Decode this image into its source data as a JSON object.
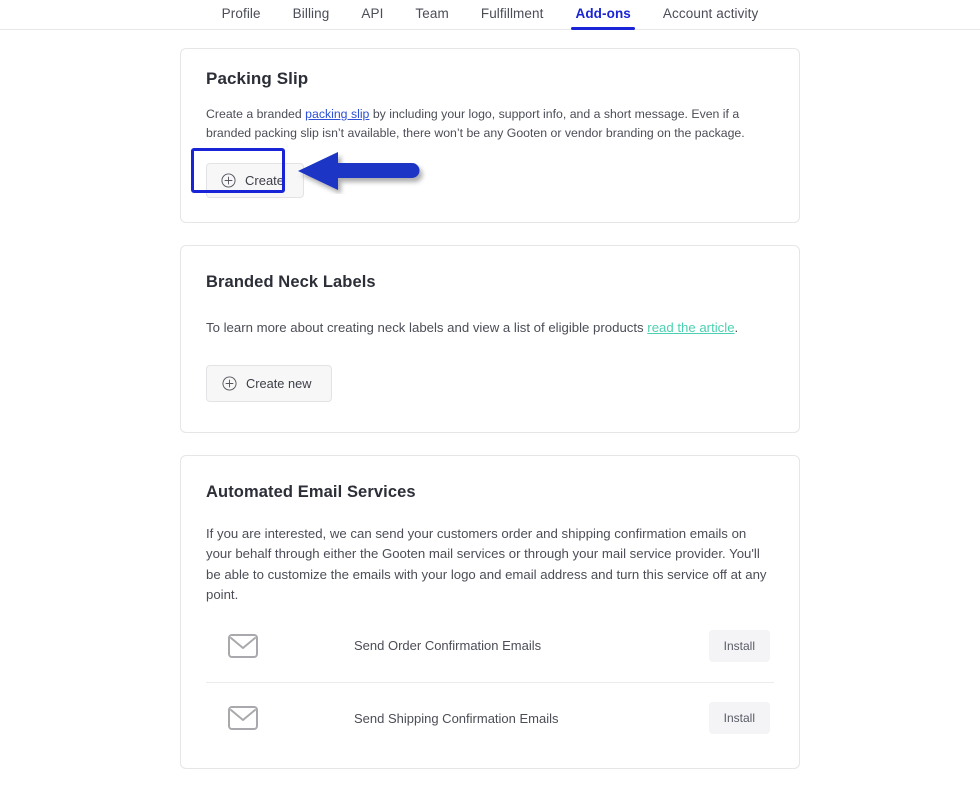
{
  "tabs": [
    {
      "label": "Profile",
      "active": false
    },
    {
      "label": "Billing",
      "active": false
    },
    {
      "label": "API",
      "active": false
    },
    {
      "label": "Team",
      "active": false
    },
    {
      "label": "Fulfillment",
      "active": false
    },
    {
      "label": "Add-ons",
      "active": true
    },
    {
      "label": "Account activity",
      "active": false
    }
  ],
  "packing_slip": {
    "title": "Packing Slip",
    "body_before_link": "Create a branded ",
    "link_text": "packing slip",
    "body_after_link": " by including your logo, support info, and a short message. Even if a branded packing slip isn’t available, there won’t be any Gooten or vendor branding on the package.",
    "create_label": "Create"
  },
  "neck_labels": {
    "title": "Branded Neck Labels",
    "body_before_link": "To learn more about creating neck labels and view a list of eligible products ",
    "link_text": "read the article",
    "body_after_link": ".",
    "create_label": "Create new"
  },
  "email_services": {
    "title": "Automated Email Services",
    "body": "If you are interested, we can send your customers order and shipping confirmation emails on your behalf through either the Gooten mail services or through your mail service provider. You'll be able to customize the emails with your logo and email address and turn this service off at any point.",
    "rows": [
      {
        "label": "Send Order Confirmation Emails",
        "button": "Install",
        "icon": "envelope-icon"
      },
      {
        "label": "Send Shipping Confirmation Emails",
        "button": "Install",
        "icon": "envelope-icon"
      }
    ]
  },
  "colors": {
    "accent_blue": "#1824d6",
    "link_blue": "#2b4fd8",
    "link_teal": "#4dd0b1",
    "annotation": "#1a35c4",
    "card_border": "#e6e6e8",
    "button_bg": "#f7f7f8"
  }
}
